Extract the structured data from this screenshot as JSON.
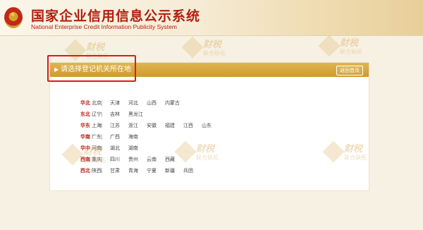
{
  "header": {
    "title": "国家企业信用信息公示系统",
    "subtitle": "National Enterprise Credit Information Publicity System"
  },
  "panel": {
    "title": "请选择登记机关所在地",
    "home_button": "返回首页",
    "regions": [
      {
        "name": "华北",
        "cities": [
          "北京",
          "天津",
          "河北",
          "山西",
          "内蒙古"
        ]
      },
      {
        "name": "东北",
        "cities": [
          "辽宁",
          "吉林",
          "黑龙江"
        ]
      },
      {
        "name": "华东",
        "cities": [
          "上海",
          "江苏",
          "浙江",
          "安徽",
          "福建",
          "江西",
          "山东"
        ]
      },
      {
        "name": "华南",
        "cities": [
          "广东",
          "广西",
          "海南"
        ]
      },
      {
        "name": "华中",
        "cities": [
          "河南",
          "湖北",
          "湖南"
        ]
      },
      {
        "name": "西南",
        "cities": [
          "重庆",
          "四川",
          "贵州",
          "云南",
          "西藏"
        ]
      },
      {
        "name": "西北",
        "cities": [
          "陕西",
          "甘肃",
          "青海",
          "宁夏",
          "新疆",
          "兵团"
        ]
      }
    ],
    "separator": "|"
  },
  "watermark": {
    "line1": "财税",
    "line2": "联合联拓"
  },
  "colors": {
    "brand_red": "#b11e10",
    "bar_gold": "#d7a640",
    "highlight_red": "#e0191b"
  }
}
